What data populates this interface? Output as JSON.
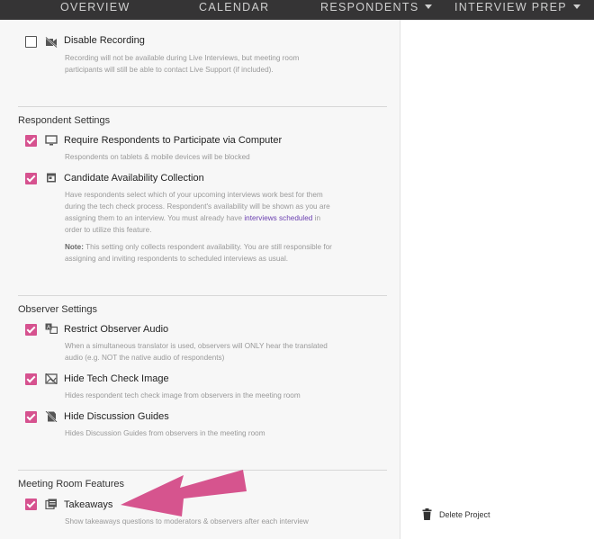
{
  "nav": {
    "overview": "OVERVIEW",
    "calendar": "CALENDAR",
    "respondents": "RESPONDENTS",
    "interview_prep": "INTERVIEW PREP"
  },
  "recording": {
    "label": "Disable Recording",
    "checked": false,
    "desc_1": "Recording will not be available during Live Interviews, but meeting room",
    "desc_2": "participants will still be able to contact Live Support (if included)."
  },
  "respondent_settings": {
    "title": "Respondent Settings",
    "computer": {
      "label": "Require Respondents to Participate via Computer",
      "checked": true,
      "desc": "Respondents on tablets & mobile devices will be blocked"
    },
    "availability": {
      "label": "Candidate Availability Collection",
      "checked": true,
      "desc_1": "Have respondents select which of your upcoming interviews work best for them",
      "desc_2": "during the tech check process. Respondent's availability will be shown as you are",
      "desc_3": "assigning them to an interview. You must already have",
      "link": "interviews scheduled",
      "desc_3_end": "in",
      "desc_4": "order to utilize this feature.",
      "note_label": "Note:",
      "note_1": "This setting only collects respondent availability. You are still responsible for",
      "note_2": "assigning and inviting respondents to scheduled interviews as usual."
    }
  },
  "observer_settings": {
    "title": "Observer Settings",
    "audio": {
      "label": "Restrict Observer Audio",
      "checked": true,
      "desc_1": "When a simultaneous translator is used, observers will ONLY hear the translated",
      "desc_2": "audio (e.g. NOT the native audio of respondents)"
    },
    "tech_check": {
      "label": "Hide Tech Check Image",
      "checked": true,
      "desc": "Hides respondent tech check image from observers in the meeting room"
    },
    "guides": {
      "label": "Hide Discussion Guides",
      "checked": true,
      "desc": "Hides Discussion Guides from observers in the meeting room"
    }
  },
  "meeting_room": {
    "title": "Meeting Room Features",
    "takeaways": {
      "label": "Takeaways",
      "checked": true,
      "desc": "Show takeaways questions to moderators & observers after each interview"
    }
  },
  "sidebar": {
    "delete_project": "Delete Project"
  },
  "colors": {
    "accent": "#d6528f",
    "nav_bg": "#353435",
    "link": "#6a3fb0",
    "arrow": "#d6548e"
  }
}
